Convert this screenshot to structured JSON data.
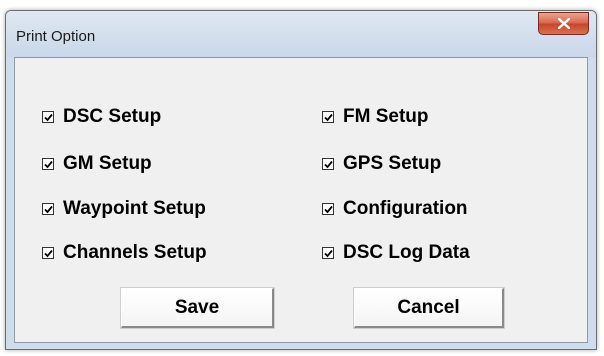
{
  "window": {
    "title": "Print Option"
  },
  "options": {
    "dsc_setup": {
      "label": "DSC Setup",
      "checked": true
    },
    "gm_setup": {
      "label": "GM Setup",
      "checked": true
    },
    "waypoint_setup": {
      "label": "Waypoint Setup",
      "checked": true
    },
    "channels_setup": {
      "label": "Channels Setup",
      "checked": true
    },
    "fm_setup": {
      "label": "FM Setup",
      "checked": true
    },
    "gps_setup": {
      "label": "GPS Setup",
      "checked": true
    },
    "configuration": {
      "label": "Configuration",
      "checked": true
    },
    "dsc_log_data": {
      "label": "DSC Log Data",
      "checked": true
    }
  },
  "buttons": {
    "save_label": "Save",
    "cancel_label": "Cancel"
  },
  "icons": {
    "close": "close-icon",
    "checkmark": "checkmark-icon"
  },
  "colors": {
    "frame": "#cfdcec",
    "client": "#f0f0f0",
    "close_button": "#c7432b"
  }
}
